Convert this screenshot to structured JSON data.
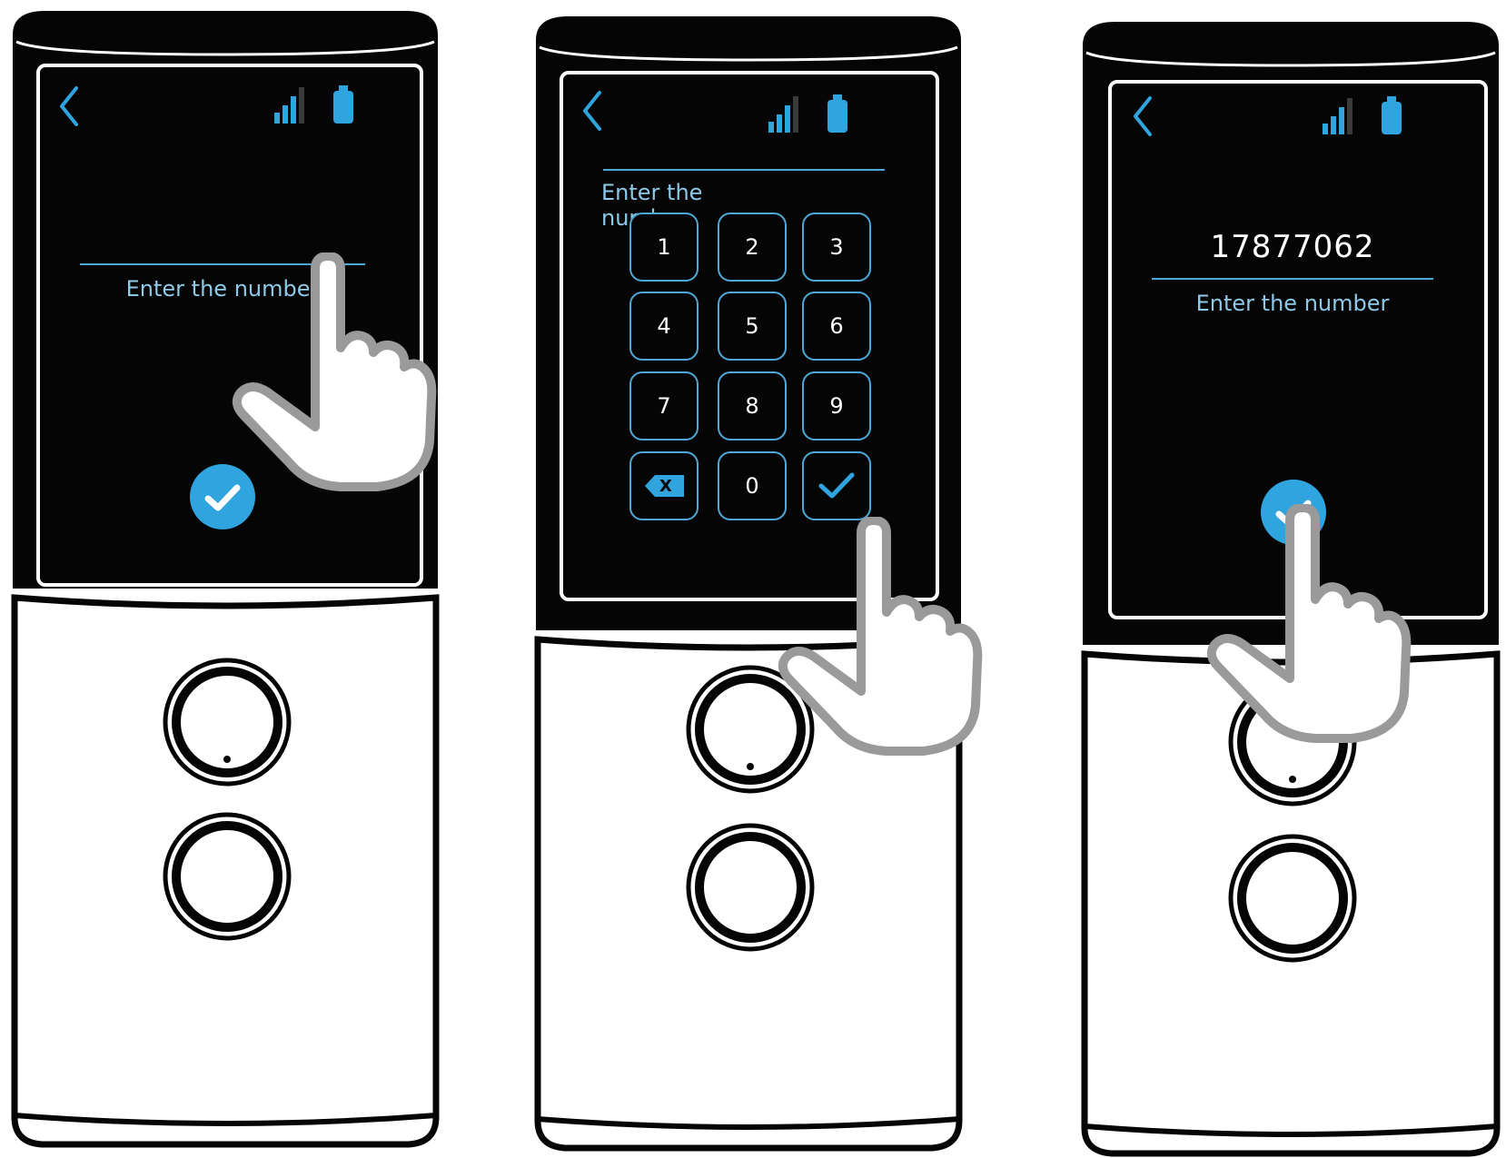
{
  "accent_color": "#2fa4df",
  "screen_color": "#050505",
  "panels": [
    {
      "step": 1,
      "label": "Enter the number",
      "value": "",
      "confirm_icon": "check-icon",
      "gesture": "hand-pointer-icon tapping input line"
    },
    {
      "step": 2,
      "label": "Enter the number",
      "keypad": [
        "1",
        "2",
        "3",
        "4",
        "5",
        "6",
        "7",
        "8",
        "9",
        "X",
        "0"
      ],
      "backspace_icon": "backspace-icon",
      "confirm_icon": "check-icon",
      "gesture": "hand-pointer-icon tapping confirm key"
    },
    {
      "step": 3,
      "label": "Enter the number",
      "value": "17877062",
      "confirm_icon": "check-icon",
      "gesture": "hand-pointer-icon tapping confirm button"
    }
  ],
  "status_icons": [
    "back-arrow-icon",
    "signal-icon",
    "battery-icon"
  ]
}
